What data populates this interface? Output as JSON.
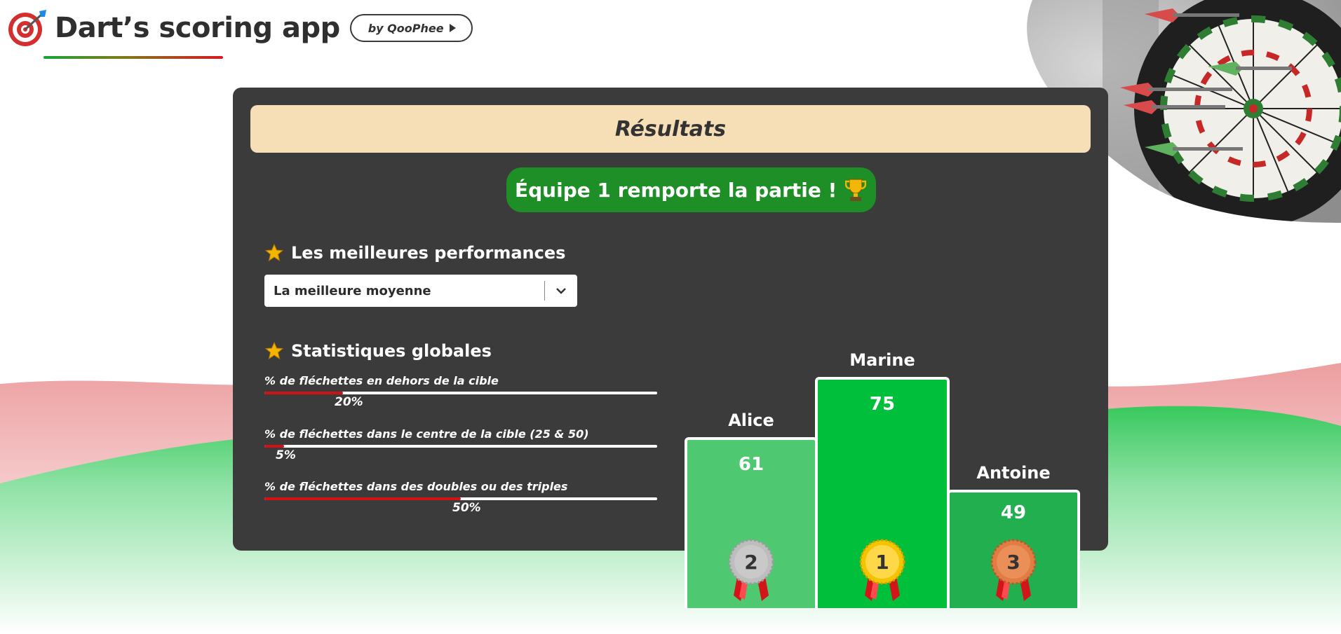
{
  "app": {
    "title": "Dart’s scoring app",
    "by_label": "by QooPhee"
  },
  "results": {
    "title": "Résultats",
    "winner_text": "Équipe 1 remporte la partie !",
    "best_section_title": "Les meilleures performances",
    "select": {
      "value": "La meilleure moyenne"
    },
    "global_section_title": "Statistiques globales",
    "stats": [
      {
        "label": "% de fléchettes en dehors de la cible",
        "value": "20%",
        "percent": 20
      },
      {
        "label": "% de fléchettes dans le centre de la cible (25 & 50)",
        "value": "5%",
        "percent": 5
      },
      {
        "label": "% de fléchettes dans des doubles ou des triples",
        "value": "50%",
        "percent": 50
      }
    ],
    "podium": [
      {
        "rank": "2",
        "name": "Alice",
        "score": "61",
        "color": "#4fc971"
      },
      {
        "rank": "1",
        "name": "Marine",
        "score": "75",
        "color": "#00bf3a"
      },
      {
        "rank": "3",
        "name": "Antoine",
        "score": "49",
        "color": "#21af4f"
      }
    ]
  },
  "colors": {
    "panel": "#3b3b3b",
    "header": "#f6dfb6",
    "winner_bg": "#1e8f26",
    "progress": "#d01215",
    "gold": "#f4c400",
    "silver": "#bdbdbd",
    "bronze": "#e17c44"
  },
  "icons": [
    "target-logo-icon",
    "play-icon",
    "trophy-icon",
    "star-icon",
    "chevron-down-icon",
    "medal-icon"
  ]
}
